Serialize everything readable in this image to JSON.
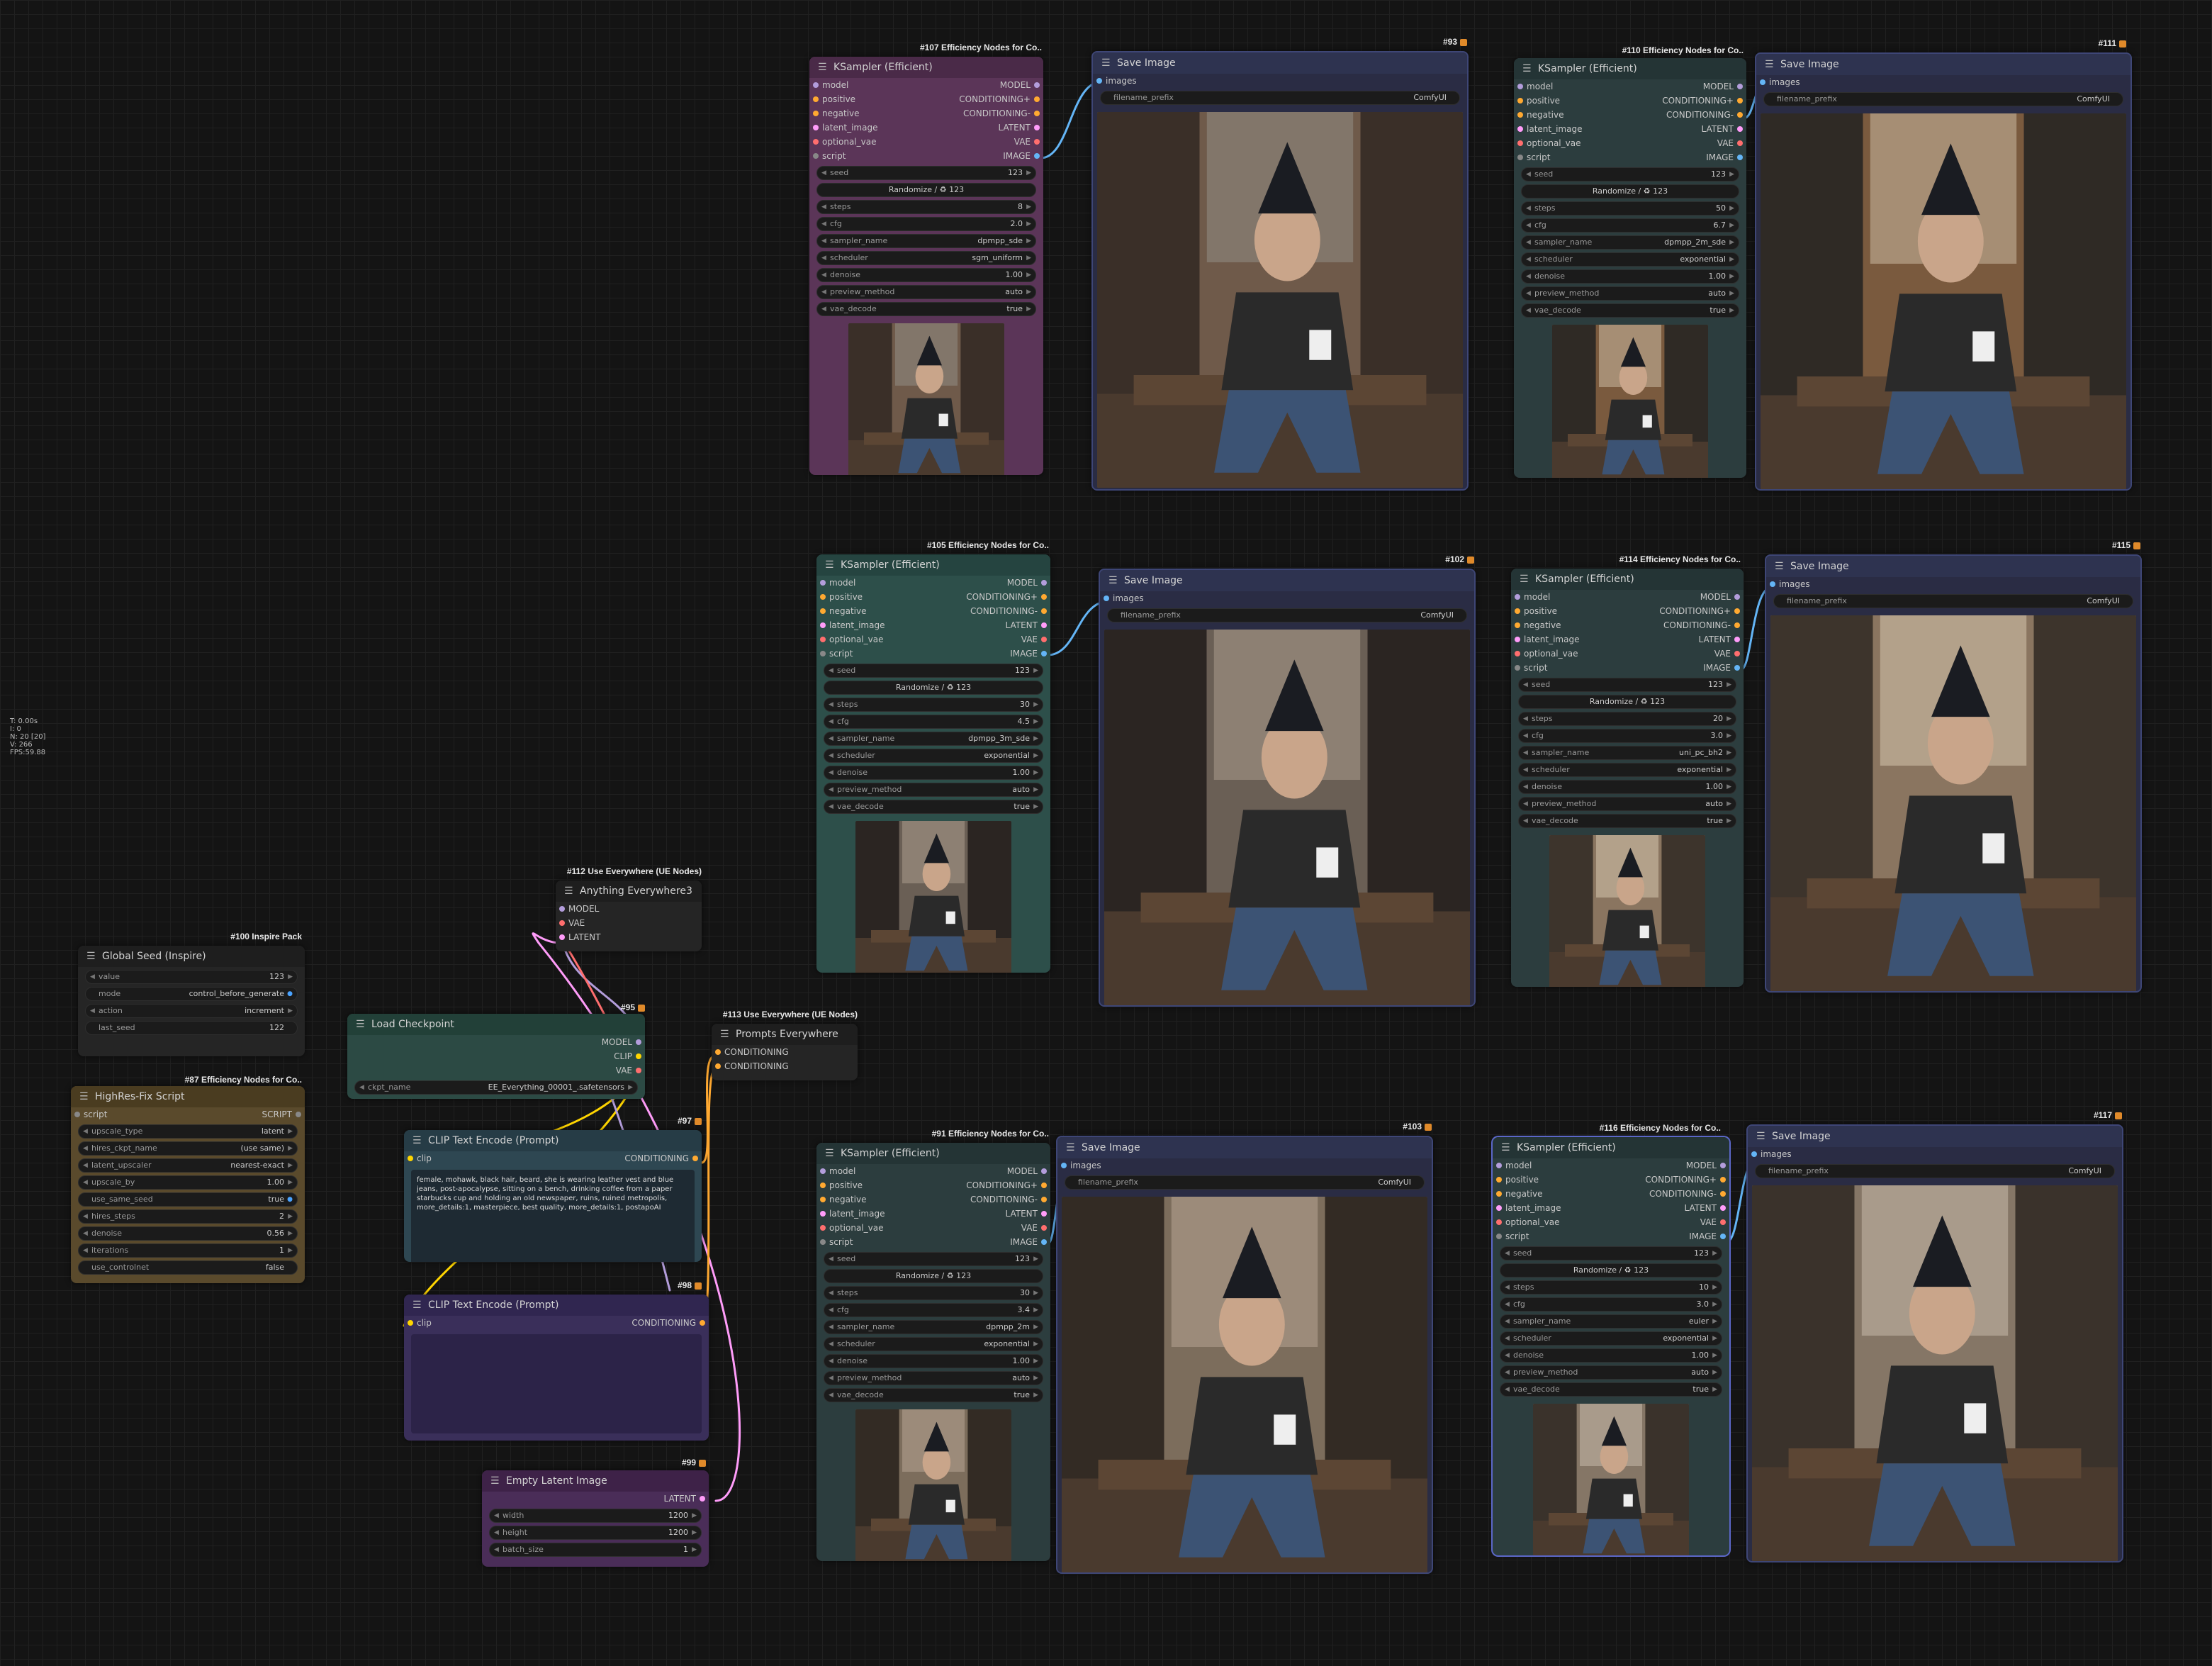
{
  "stats": [
    "T: 0.00s",
    "I: 0",
    "N: 20 [20]",
    "V: 266",
    "FPS:59.88"
  ],
  "badges": {
    "b107": "#107 Efficiency Nodes for Co..",
    "b93": "#93",
    "b110": "#110 Efficiency Nodes for Co..",
    "b111": "#111",
    "b105": "#105 Efficiency Nodes for Co..",
    "b102": "#102",
    "b114": "#114 Efficiency Nodes for Co..",
    "b115": "#115",
    "b91": "#91 Efficiency Nodes for Co..",
    "b103": "#103",
    "b116": "#116 Efficiency Nodes for Co..",
    "b117": "#117",
    "b112": "#112 Use Everywhere (UE Nodes)",
    "b95": "#95",
    "b113": "#113 Use Everywhere (UE Nodes)",
    "b97": "#97",
    "b98": "#98",
    "b99": "#99",
    "b100": "#100 Inspire Pack",
    "b87": "#87 Efficiency Nodes for Co.."
  },
  "ksampler": {
    "title": "KSampler (Efficient)",
    "inputs": [
      "model",
      "positive",
      "negative",
      "latent_image",
      "optional_vae",
      "script"
    ],
    "outputs": [
      "MODEL",
      "CONDITIONING+",
      "CONDITIONING-",
      "LATENT",
      "VAE",
      "IMAGE"
    ],
    "seed_label": "seed",
    "seed": "123",
    "randomize": "Randomize / ♻ 123",
    "labels": [
      "steps",
      "cfg",
      "sampler_name",
      "scheduler",
      "denoise",
      "preview_method",
      "vae_decode"
    ]
  },
  "ks107": [
    "8",
    "2.0",
    "dpmpp_sde",
    "sgm_uniform",
    "1.00",
    "auto",
    "true"
  ],
  "ks110": [
    "50",
    "6.7",
    "dpmpp_2m_sde",
    "exponential",
    "1.00",
    "auto",
    "true"
  ],
  "ks105": [
    "30",
    "4.5",
    "dpmpp_3m_sde",
    "exponential",
    "1.00",
    "auto",
    "true"
  ],
  "ks114": [
    "20",
    "3.0",
    "uni_pc_bh2",
    "exponential",
    "1.00",
    "auto",
    "true"
  ],
  "ks91": [
    "30",
    "3.4",
    "dpmpp_2m",
    "exponential",
    "1.00",
    "auto",
    "true"
  ],
  "ks116": [
    "10",
    "3.0",
    "euler",
    "exponential",
    "1.00",
    "auto",
    "true"
  ],
  "save": {
    "title": "Save Image",
    "input": "images",
    "prefix_label": "filename_prefix",
    "prefix": "ComfyUI"
  },
  "anything": {
    "title": "Anything Everywhere3",
    "inputs": [
      "MODEL",
      "VAE",
      "LATENT"
    ]
  },
  "prompts": {
    "title": "Prompts Everywhere",
    "inputs": [
      "CONDITIONING",
      "CONDITIONING"
    ]
  },
  "seed_node": {
    "title": "Global Seed (Inspire)",
    "labels": [
      "value",
      "mode",
      "action",
      "last_seed"
    ],
    "values": [
      "123",
      "control_before_generate",
      "increment",
      "122"
    ]
  },
  "load": {
    "title": "Load Checkpoint",
    "outputs": [
      "MODEL",
      "CLIP",
      "VAE"
    ],
    "ckpt_label": "ckpt_name",
    "ckpt": "EE_Everything_00001_.safetensors"
  },
  "clip_pos": {
    "title": "CLIP Text Encode (Prompt)",
    "input": "clip",
    "output": "CONDITIONING",
    "text": "female, mohawk, black hair, beard, she is wearing leather vest and blue jeans, post-apocalypse, sitting on a bench, drinking coffee from a paper starbucks cup and holding an old newspaper, ruins, ruined metropolis, more_details:1, masterpiece, best quality, more_details:1, postapoAI"
  },
  "clip_neg": {
    "title": "CLIP Text Encode (Prompt)",
    "input": "clip",
    "output": "CONDITIONING"
  },
  "hires": {
    "title": "HighRes-Fix Script",
    "input": "script",
    "output": "SCRIPT",
    "labels": [
      "upscale_type",
      "hires_ckpt_name",
      "latent_upscaler",
      "upscale_by",
      "use_same_seed",
      "hires_steps",
      "denoise",
      "iterations",
      "use_controlnet"
    ],
    "values": [
      "latent",
      "(use same)",
      "nearest-exact",
      "1.00",
      "true",
      "2",
      "0.56",
      "1",
      "false"
    ]
  },
  "latent": {
    "title": "Empty Latent Image",
    "output": "LATENT",
    "labels": [
      "width",
      "height",
      "batch_size"
    ],
    "values": [
      "1200",
      "1200",
      "1"
    ]
  },
  "colors": {
    "model": "#b39ddb",
    "conditioning": "#ffa931",
    "latent": "#ff9cf9",
    "vae": "#ff6e6e",
    "clip": "#ffd500",
    "image": "#64b5f6",
    "script": "#888"
  }
}
